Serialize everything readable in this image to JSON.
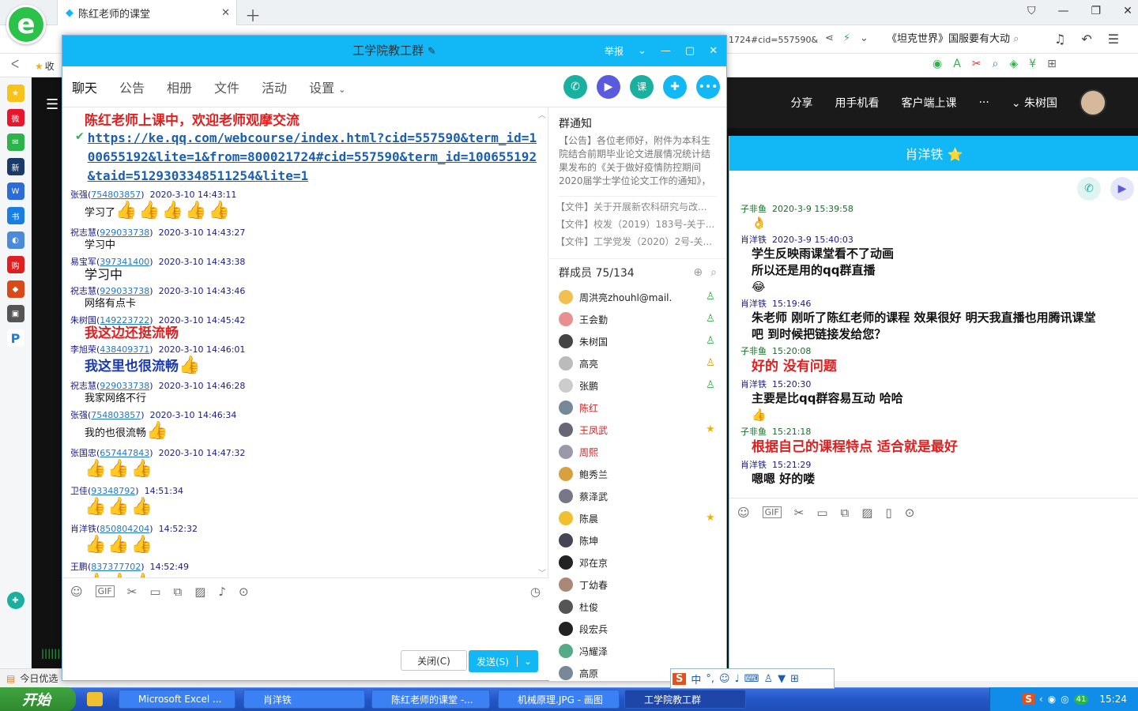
{
  "browser": {
    "tab_title": "陈红老师的课堂",
    "url_tail": "1724#cid=557590&",
    "search_text": "《坦克世界》国服要有大动",
    "bookmark_label": "收",
    "bottom_left_text": "今日优选"
  },
  "page": {
    "top_links": [
      "分享",
      "用手机看",
      "客户端上课",
      "···"
    ],
    "user_name": "朱树国"
  },
  "group_window": {
    "title": "工学院教工群",
    "report": "举报",
    "tabs": [
      "聊天",
      "公告",
      "相册",
      "文件",
      "活动",
      "设置"
    ],
    "messages": [
      {
        "type": "banner",
        "text": "陈红老师上课中，欢迎老师观摩交流",
        "color": "#e02020"
      },
      {
        "type": "link",
        "text": "https://ke.qq.com/webcourse/index.html?cid=557590&term_id=100655192&lite=1&from=800021724#cid=557590&term_id=100655192&taid=5129303348511254&lite=1"
      },
      {
        "name": "张强",
        "qq": "754803857",
        "time": "2020-3-10 14:43:11",
        "text": "学习了",
        "thumbs": 5,
        "style": "plain"
      },
      {
        "name": "祝志慧",
        "qq": "929033738",
        "time": "2020-3-10 14:43:27",
        "text": "学习中",
        "thumbs": 0,
        "style": "plain"
      },
      {
        "name": "易宝军",
        "qq": "397341400",
        "time": "2020-3-10 14:43:38",
        "text": "学习中",
        "thumbs": 0,
        "style": "big"
      },
      {
        "name": "祝志慧",
        "qq": "929033738",
        "time": "2020-3-10 14:43:46",
        "text": "网络有点卡",
        "thumbs": 0,
        "style": "plain"
      },
      {
        "name": "朱树国",
        "qq": "149223722",
        "time": "2020-3-10 14:45:42",
        "text": "我这边还挺流畅",
        "thumbs": 0,
        "style": "red"
      },
      {
        "name": "李旭荣",
        "qq": "438409371",
        "time": "2020-3-10 14:46:01",
        "text": "我这里也很流畅",
        "thumbs": 1,
        "style": "blue"
      },
      {
        "name": "祝志慧",
        "qq": "929033738",
        "time": "2020-3-10 14:46:28",
        "text": "我家网络不行",
        "thumbs": 0,
        "style": "plain"
      },
      {
        "name": "张强",
        "qq": "754803857",
        "time": "2020-3-10 14:46:34",
        "text": "我的也很流畅",
        "thumbs": 1,
        "style": "plain"
      },
      {
        "name": "张国忠",
        "qq": "657447843",
        "time": "2020-3-10 14:47:32",
        "text": "",
        "thumbs": 3,
        "style": "plain"
      },
      {
        "name": "卫佳",
        "qq": "93348792",
        "time": "14:51:34",
        "text": "",
        "thumbs": 3,
        "style": "plain"
      },
      {
        "name": "肖洋铁",
        "qq": "850804204",
        "time": "14:52:32",
        "text": "",
        "thumbs": 3,
        "style": "plain"
      },
      {
        "name": "王鹏",
        "qq": "837377702",
        "time": "14:52:49",
        "text": "",
        "thumbs": 3,
        "style": "plain"
      }
    ],
    "close_label": "关闭(C)",
    "send_label": "发送(S)",
    "notice_title": "群通知",
    "notice_text": "【公告】各位老师好，附件为本科生院结合前期毕业论文进展情况统计结果发布的《关于做好疫情防控期间2020届学士学位论文工作的通知》，为...",
    "files": [
      "【文件】关于开展新农科研究与改...",
      "【文件】校发（2019）183号-关于...",
      "【文件】工学党发（2020）2号-关..."
    ],
    "members_label": "群成员 75/134",
    "members": [
      {
        "name": "周洪亮zhouhl@mail.",
        "color": "#222",
        "badge": "person",
        "avcolor": "#f0c050"
      },
      {
        "name": "王会勤",
        "color": "#222",
        "badge": "person",
        "avcolor": "#e89090"
      },
      {
        "name": "朱树国",
        "color": "#222",
        "badge": "person",
        "avcolor": "#444"
      },
      {
        "name": "高亮",
        "color": "#222",
        "badge": "person-star",
        "avcolor": "#bbb"
      },
      {
        "name": "张鹏",
        "color": "#222",
        "badge": "person",
        "avcolor": "#ccc"
      },
      {
        "name": "陈红",
        "color": "#d02020",
        "badge": "",
        "avcolor": "#789"
      },
      {
        "name": "王凤武",
        "color": "#d02020",
        "badge": "star",
        "avcolor": "#667"
      },
      {
        "name": "周熙",
        "color": "#d02020",
        "badge": "",
        "avcolor": "#99a"
      },
      {
        "name": "鲍秀兰",
        "color": "#222",
        "badge": "",
        "avcolor": "#d9a040"
      },
      {
        "name": "蔡泽武",
        "color": "#222",
        "badge": "",
        "avcolor": "#778"
      },
      {
        "name": "陈晨",
        "color": "#222",
        "badge": "star",
        "avcolor": "#f0c030"
      },
      {
        "name": "陈坤",
        "color": "#222",
        "badge": "",
        "avcolor": "#445"
      },
      {
        "name": "邓在京",
        "color": "#222",
        "badge": "",
        "avcolor": "#222"
      },
      {
        "name": "丁幼春",
        "color": "#222",
        "badge": "",
        "avcolor": "#a87"
      },
      {
        "name": "杜俊",
        "color": "#222",
        "badge": "",
        "avcolor": "#555"
      },
      {
        "name": "段宏兵",
        "color": "#222",
        "badge": "",
        "avcolor": "#222"
      },
      {
        "name": "冯耀泽",
        "color": "#222",
        "badge": "",
        "avcolor": "#5a8"
      },
      {
        "name": "高原",
        "color": "#222",
        "badge": "",
        "avcolor": "#789"
      }
    ]
  },
  "private_window": {
    "title": "肖洋铁 ⭐",
    "messages": [
      {
        "name": "子非鱼",
        "time": "2020-3-9 15:39:58",
        "lines": [
          "👌"
        ],
        "style": "plain",
        "namecolor": "green"
      },
      {
        "name": "肖洋铁",
        "time": "2020-3-9 15:40:03",
        "lines": [
          "学生反映雨课堂看不了动画",
          "所以还是用的qq群直播",
          "😂"
        ],
        "style": "plain",
        "namecolor": "blue"
      },
      {
        "name": "肖洋铁",
        "time": "15:19:46",
        "lines": [
          "朱老师 刚听了陈红老师的课程 效果很好 明天我直播也用腾讯课堂",
          "吧  到时候把链接发给您？"
        ],
        "style": "plain",
        "namecolor": "blue"
      },
      {
        "name": "子非鱼",
        "time": "15:20:08",
        "lines": [
          "好的   没有问题"
        ],
        "style": "red",
        "namecolor": "green"
      },
      {
        "name": "肖洋铁",
        "time": "15:20:30",
        "lines": [
          "主要是比qq群容易互动 哈哈",
          "👍"
        ],
        "style": "plain",
        "namecolor": "blue"
      },
      {
        "name": "子非鱼",
        "time": "15:21:18",
        "lines": [
          "根据自己的课程特点   适合就是最好"
        ],
        "style": "red",
        "namecolor": "green"
      },
      {
        "name": "肖洋铁",
        "time": "15:21:29",
        "lines": [
          "嗯嗯 好的喽"
        ],
        "style": "plain",
        "namecolor": "blue"
      }
    ]
  },
  "taskbar": {
    "start": "开始",
    "items": [
      "Microsoft Excel ...",
      "肖洋铁",
      "陈红老师的课堂 -...",
      "机械原理.JPG - 画图",
      "工学院教工群"
    ],
    "clock": "15:24",
    "tray_number": "41"
  },
  "ime": {
    "label": "中"
  }
}
